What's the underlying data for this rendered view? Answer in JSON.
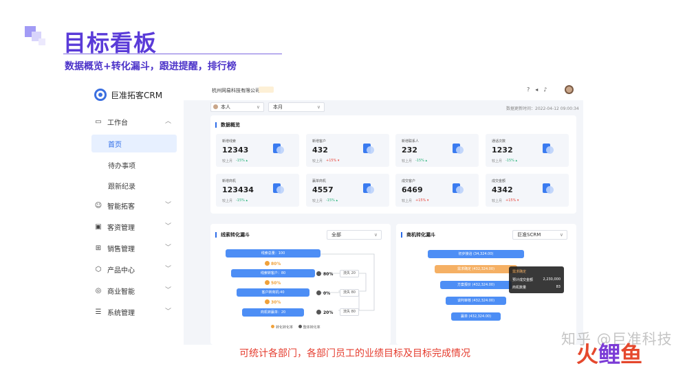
{
  "slide": {
    "title": "目标看板",
    "subtitle": "数据概览+转化漏斗，跟进提醒，排行榜",
    "caption": "可统计各部门，各部门员工的业绩目标及目标完成情况",
    "watermark": "知乎 @巨准科技",
    "brand": [
      "火",
      "鲤",
      "鱼"
    ]
  },
  "app": {
    "logo": "巨准拓客CRM",
    "company": "杭州网易科技有限公司",
    "update_time": "数据更新时间：2022-04-12 09:00:34",
    "filters": {
      "person": "本人",
      "period": "本月"
    },
    "top_icons": [
      "help-icon",
      "speaker-icon",
      "bell-icon"
    ]
  },
  "sidebar": {
    "items": [
      {
        "label": "工作台",
        "icon": "monitor-icon",
        "expanded": true,
        "children": [
          "首页",
          "待办事项",
          "跟新纪录"
        ]
      },
      {
        "label": "智能拓客",
        "icon": "smile-icon"
      },
      {
        "label": "客资管理",
        "icon": "contact-icon"
      },
      {
        "label": "销售管理",
        "icon": "grid-icon"
      },
      {
        "label": "产品中心",
        "icon": "box-icon"
      },
      {
        "label": "商业智能",
        "icon": "target-icon"
      },
      {
        "label": "系统管理",
        "icon": "sliders-icon"
      }
    ],
    "active_child": "首页"
  },
  "overview": {
    "title": "数据概览",
    "compare_label": "较上月",
    "cards": [
      {
        "label": "新增线索",
        "value": "12343",
        "change": "-15%",
        "dir": "up"
      },
      {
        "label": "新增客户",
        "value": "432",
        "change": "+15%",
        "dir": "down"
      },
      {
        "label": "新增联系人",
        "value": "232",
        "change": "-15%",
        "dir": "up"
      },
      {
        "label": "通话次数",
        "value": "1232",
        "change": "-15%",
        "dir": "up"
      },
      {
        "label": "新增商机",
        "value": "123434",
        "change": "-15%",
        "dir": "up"
      },
      {
        "label": "赢单商机",
        "value": "4557",
        "change": "-15%",
        "dir": "up"
      },
      {
        "label": "成交客户",
        "value": "6469",
        "change": "+15%",
        "dir": "down"
      },
      {
        "label": "成交金额",
        "value": "4342",
        "change": "+15%",
        "dir": "down"
      }
    ]
  },
  "lead_funnel": {
    "title": "线索转化漏斗",
    "select": "全部",
    "stages": [
      "线索总量：100",
      "线索转客户：80",
      "客户转商机:40",
      "商机转赢单：20"
    ],
    "step_rates": [
      "80%",
      "50%",
      "30%"
    ],
    "overall": [
      {
        "rate": "80%",
        "loss": "流失 20"
      },
      {
        "rate": "0%",
        "loss": "流失 80"
      },
      {
        "rate": "20%",
        "loss": "流失 80"
      }
    ],
    "legend": [
      "转化转化率",
      "整体转化率"
    ]
  },
  "opp_funnel": {
    "title": "商机转化漏斗",
    "select": "巨准SCRM",
    "stages": [
      "初步接洽 (34,324.00)",
      "需求确定 (432,324.00)",
      "方案报价 (432,324.00)",
      "谈判审核 (432,324.00)",
      "赢单 (432,324.00)"
    ],
    "tooltip": {
      "title": "需求确定",
      "row1_label": "预计成交金额",
      "row1_value": "2,230,000",
      "row2_label": "商机数量",
      "row2_value": "83"
    }
  },
  "colors": {
    "accent": "#2c6be8",
    "title": "#5a3bd8",
    "caption": "#e53c2e"
  }
}
